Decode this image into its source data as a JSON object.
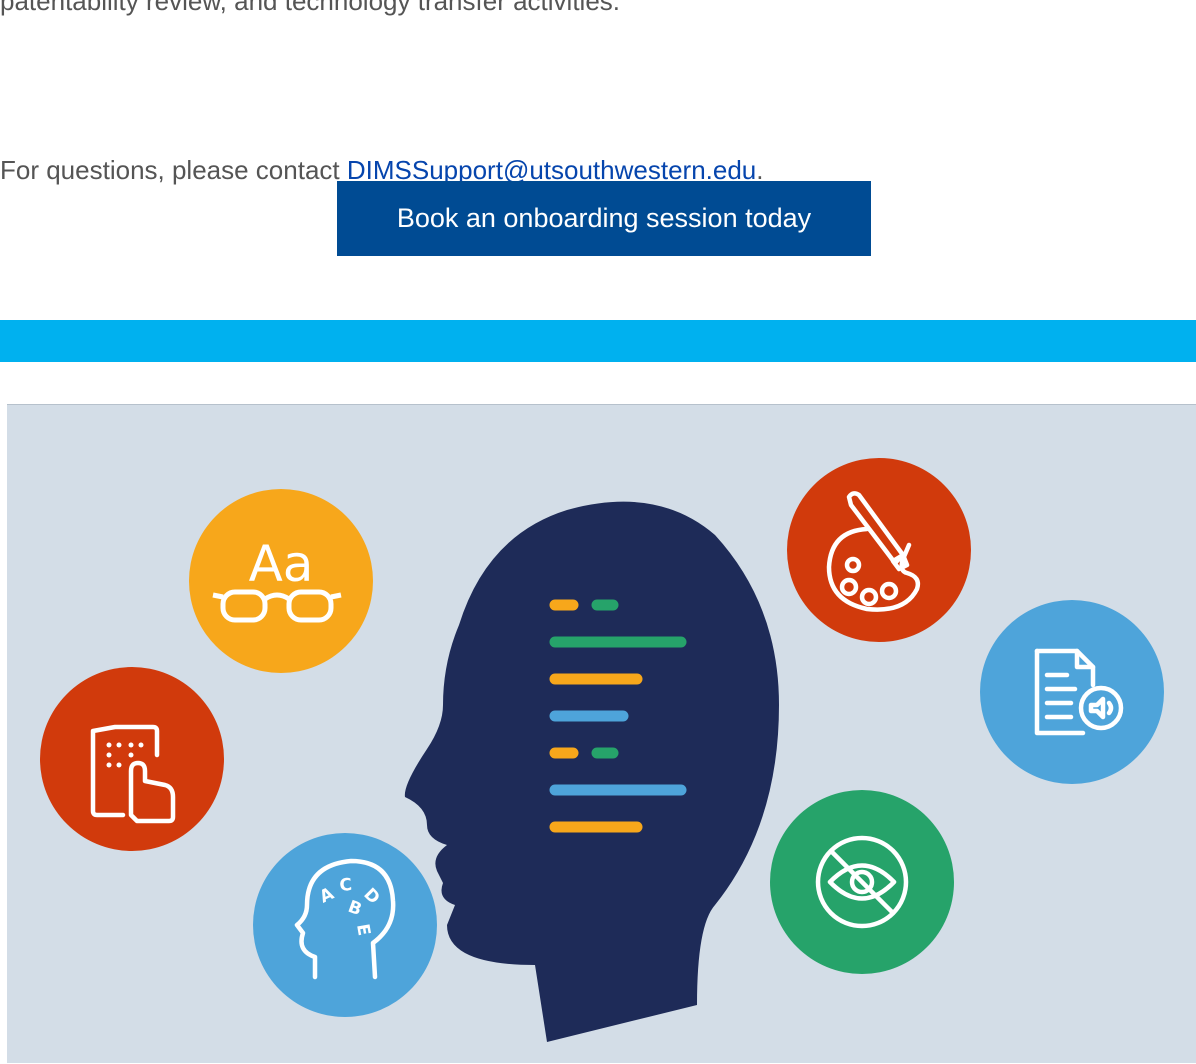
{
  "content": {
    "intro_tail": "patentability review, and technology transfer activities.",
    "contact_prefix": "For questions, please contact ",
    "contact_email": "DIMSSupport@utsouthwestern.edu",
    "contact_suffix": ".",
    "cta_label": "Book an onboarding session today"
  },
  "illustration": {
    "glasses_text": "Aa",
    "icons": [
      "braille-touch-icon",
      "reading-glasses-icon",
      "dyslexia-head-icon",
      "head-profile-icon",
      "art-palette-icon",
      "audio-document-icon",
      "low-vision-icon"
    ]
  },
  "colors": {
    "cta_bg": "#004b93",
    "band": "#00b1ef",
    "illustration_bg": "#d3dde7",
    "head": "#1e2b58",
    "orange": "#f7a71b",
    "red": "#d13a0c",
    "blue": "#4ea4da",
    "green": "#26a36a"
  }
}
